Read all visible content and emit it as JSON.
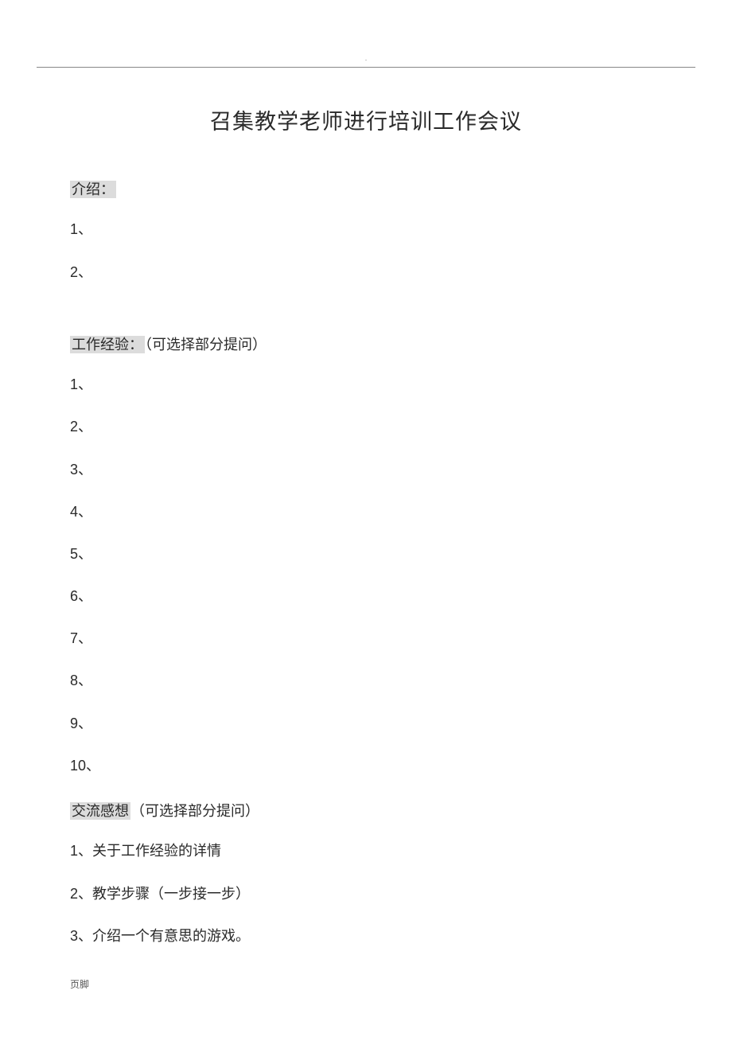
{
  "header_dot": ".",
  "title": "召集教学老师进行培训工作会议",
  "sections": {
    "intro": {
      "label": "介绍：",
      "items": [
        "1、",
        "2、"
      ]
    },
    "experience": {
      "label": "工作经验：",
      "hint": "（可选择部分提问）",
      "items": [
        "1、",
        "2、",
        "3、",
        "4、",
        "5、",
        "6、",
        "7、",
        "8、",
        "9、",
        "10、"
      ]
    },
    "thoughts": {
      "label": "交流感想",
      "hint": "（可选择部分提问）",
      "items": [
        "1、关于工作经验的详情",
        "2、教学步骤（一步接一步）",
        "3、介绍一个有意思的游戏。"
      ]
    }
  },
  "footer": "页脚"
}
